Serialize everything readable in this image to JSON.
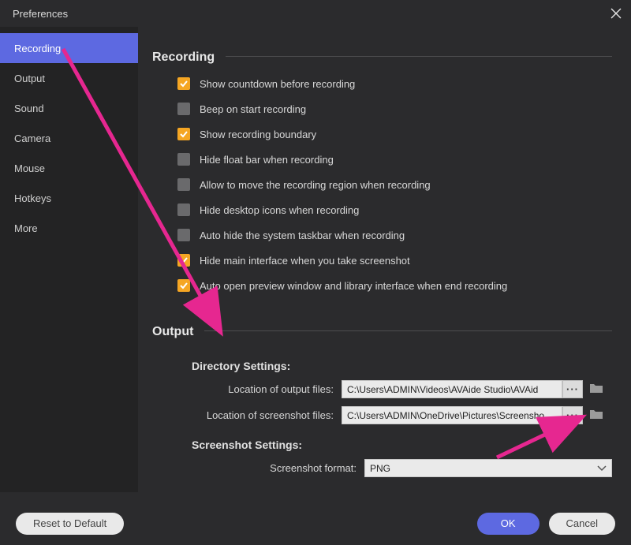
{
  "titlebar": {
    "title": "Preferences"
  },
  "sidebar": {
    "items": [
      {
        "label": "Recording",
        "active": true
      },
      {
        "label": "Output",
        "active": false
      },
      {
        "label": "Sound",
        "active": false
      },
      {
        "label": "Camera",
        "active": false
      },
      {
        "label": "Mouse",
        "active": false
      },
      {
        "label": "Hotkeys",
        "active": false
      },
      {
        "label": "More",
        "active": false
      }
    ]
  },
  "sections": {
    "recording": {
      "title": "Recording",
      "checks": [
        {
          "checked": true,
          "label": "Show countdown before recording"
        },
        {
          "checked": false,
          "label": "Beep on start recording"
        },
        {
          "checked": true,
          "label": "Show recording boundary"
        },
        {
          "checked": false,
          "label": "Hide float bar when recording"
        },
        {
          "checked": false,
          "label": "Allow to move the recording region when recording"
        },
        {
          "checked": false,
          "label": "Hide desktop icons when recording"
        },
        {
          "checked": false,
          "label": "Auto hide the system taskbar when recording"
        },
        {
          "checked": true,
          "label": "Hide main interface when you take screenshot"
        },
        {
          "checked": true,
          "label": "Auto open preview window and library interface when end recording"
        }
      ]
    },
    "output": {
      "title": "Output",
      "directory": {
        "heading": "Directory Settings:",
        "output_label": "Location of output files:",
        "output_value": "C:\\Users\\ADMIN\\Videos\\AVAide Studio\\AVAid",
        "screenshot_label": "Location of screenshot files:",
        "screenshot_value": "C:\\Users\\ADMIN\\OneDrive\\Pictures\\Screensho"
      },
      "screenshot": {
        "heading": "Screenshot Settings:",
        "format_label": "Screenshot format:",
        "format_value": "PNG"
      }
    }
  },
  "footer": {
    "reset": "Reset to Default",
    "ok": "OK",
    "cancel": "Cancel"
  },
  "colors": {
    "accent": "#5d69e1",
    "check_on": "#f5a623",
    "annotation": "#e62790"
  }
}
